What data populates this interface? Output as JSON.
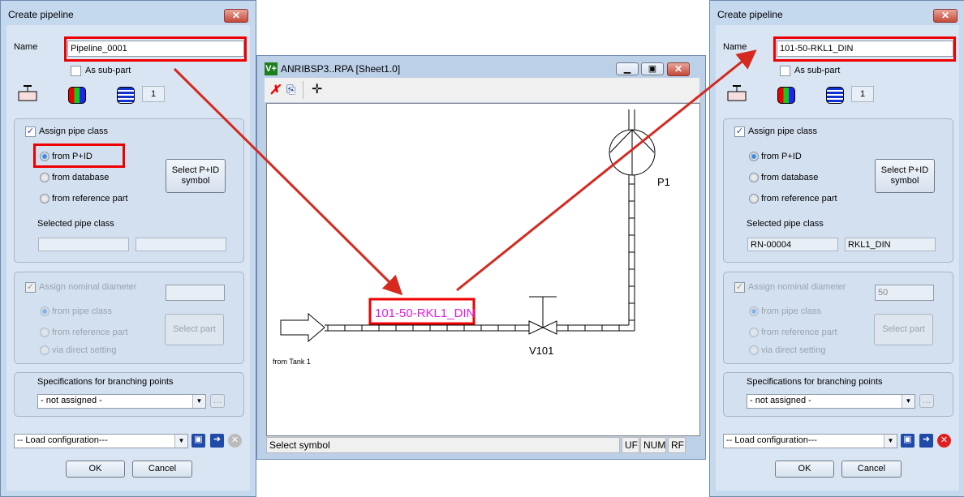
{
  "dialogs": {
    "left": {
      "title": "Create pipeline",
      "close": "✕",
      "name_label": "Name",
      "name_value": "Pipeline_0001",
      "sub_part": "As sub-part",
      "count": "1",
      "assign_pipe_class": "Assign pipe class",
      "from_pid": "from P+ID",
      "from_database": "from database",
      "from_reference": "from reference part",
      "select_pid": "Select P+ID symbol",
      "selected_pipe_class": "Selected pipe class",
      "pipe_class_1": "",
      "pipe_class_2": "",
      "assign_nominal": "Assign nominal diameter",
      "nominal_value": "",
      "from_pipe_class": "from pipe class",
      "nom_from_reference": "from reference part",
      "via_direct": "via direct setting",
      "select_part": "Select part",
      "branching": "Specifications for branching points",
      "branching_value": "- not assigned  -",
      "load_config": "-- Load configuration---",
      "ok": "OK",
      "cancel": "Cancel"
    },
    "right": {
      "title": "Create pipeline",
      "close": "✕",
      "name_label": "Name",
      "name_value": "101-50-RKL1_DIN",
      "sub_part": "As sub-part",
      "count": "1",
      "assign_pipe_class": "Assign pipe class",
      "from_pid": "from P+ID",
      "from_database": "from database",
      "from_reference": "from reference part",
      "select_pid": "Select P+ID symbol",
      "selected_pipe_class": "Selected pipe class",
      "pipe_class_1": "RN-00004",
      "pipe_class_2": "RKL1_DIN",
      "assign_nominal": "Assign nominal diameter",
      "nominal_value": "50",
      "from_pipe_class": "from pipe class",
      "nom_from_reference": "from reference part",
      "via_direct": "via direct setting",
      "select_part": "Select part",
      "branching": "Specifications for branching points",
      "branching_value": "- not assigned  -",
      "load_config": "-- Load configuration---",
      "ok": "OK",
      "cancel": "Cancel"
    }
  },
  "main": {
    "app_icon": "V+",
    "title": "ANRIBSP3..RPA [Sheet1.0]",
    "status": "Select symbol",
    "status_uf": "UF",
    "status_num": "NUM",
    "status_rf": "RF",
    "diagram": {
      "pipeline_label": "101-50-RKL1_DIN",
      "pump": "P1",
      "valve": "V101",
      "source": "from Tank 1"
    }
  },
  "colors": {
    "highlight": "#e00000",
    "pipeline_label": "#e020e0",
    "arrow": "#d42a20"
  }
}
